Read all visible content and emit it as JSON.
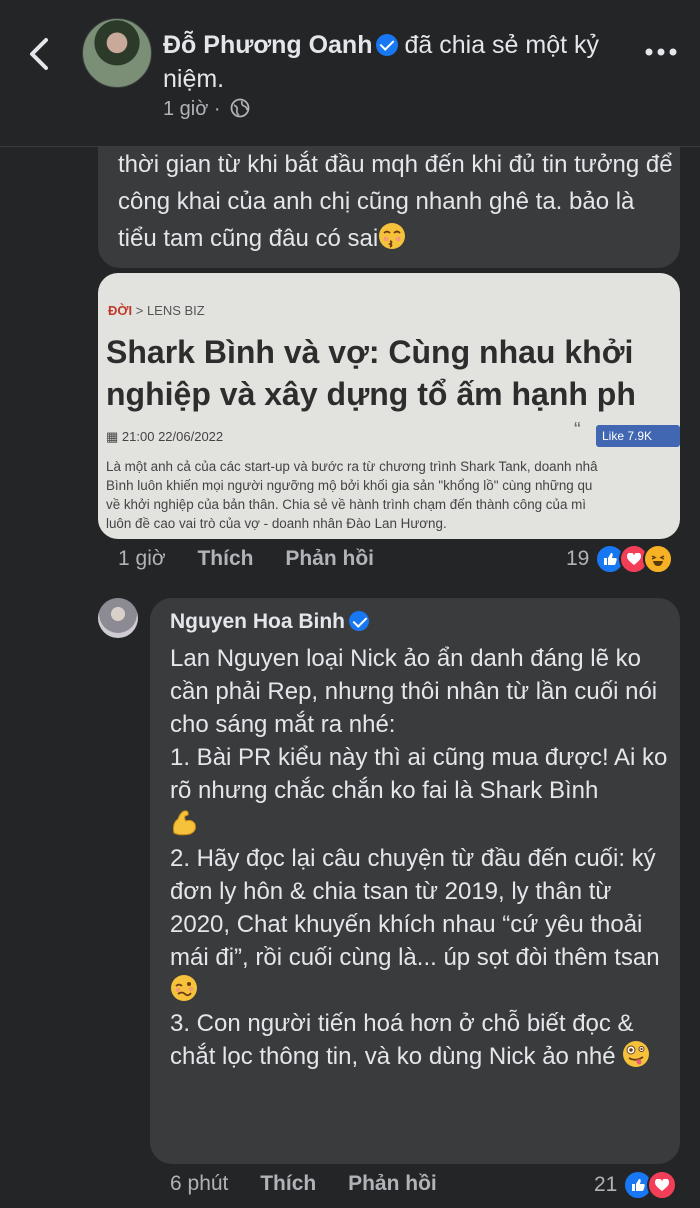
{
  "post": {
    "author": "Đỗ Phương Oanh",
    "action": "đã chia sẻ một kỷ niệm.",
    "time": "1 giờ"
  },
  "comment1": {
    "text": "thời gian từ khi bắt đầu mqh đến khi đủ tin tưởng để công khai của anh chị cũng nhanh ghê ta. bảo là tiểu tam cũng đâu có sai",
    "time": "1 giờ",
    "like_label": "Thích",
    "reply_label": "Phản hồi",
    "reaction_count": "19",
    "reactions": [
      "like-icon",
      "love-icon",
      "haha-icon"
    ]
  },
  "article": {
    "crumb_section": "ĐỜI",
    "crumb_sep": ">",
    "crumb_sub": "LENS BIZ",
    "title_line1": "Shark Bình và vợ: Cùng nhau khởi",
    "title_line2": "nghiệp và xây dựng tổ ấm hạnh ph",
    "date": "21:00 22/06/2022",
    "like_button": "Like 7.9K",
    "body_line1": "Là một anh cả của các start-up và bước ra từ chương trình Shark Tank, doanh nhâ",
    "body_line2": "Bình luôn khiến mọi người ngưỡng mộ bởi khối gia sản \"khổng lồ\" cùng những qu",
    "body_line3": "về khởi nghiệp của bản thân. Chia sẻ về hành trình chạm đến thành công của mì",
    "body_line4": "luôn đề cao vai trò của vợ - doanh nhân Đào Lan Hương."
  },
  "reply": {
    "author": "Nguyen Hoa Binh",
    "line1": "Lan Nguyen loại Nick ảo ẩn danh đáng lẽ ko cần phải Rep, nhưng thôi nhân từ lần cuối nói cho sáng mắt ra nhé:",
    "line2": "1. Bài PR kiểu này thì ai cũng mua được! Ai ko rõ nhưng chắc chắn ko fai là Shark Bình",
    "line3": "2. Hãy đọc lại câu chuyện từ đầu đến cuối: ký đơn ly hôn & chia tsan từ 2019, ly thân từ 2020, Chat khuyến khích nhau “cứ yêu thoải mái đi”, rồi cuối cùng là... úp sọt đòi thêm tsan",
    "line4": "3. Con người tiến hoá hơn ở chỗ biết đọc & chắt lọc thông tin, và ko dùng Nick ảo nhé",
    "time": "6 phút",
    "like_label": "Thích",
    "reply_label": "Phản hồi",
    "reaction_count": "21",
    "reactions": [
      "like-icon",
      "love-icon"
    ]
  },
  "colors": {
    "background": "#242526",
    "bubble": "#3a3b3c",
    "verified": "#1877f2",
    "like": "#1877f2",
    "love": "#f33e58",
    "haha": "#f7b125"
  }
}
